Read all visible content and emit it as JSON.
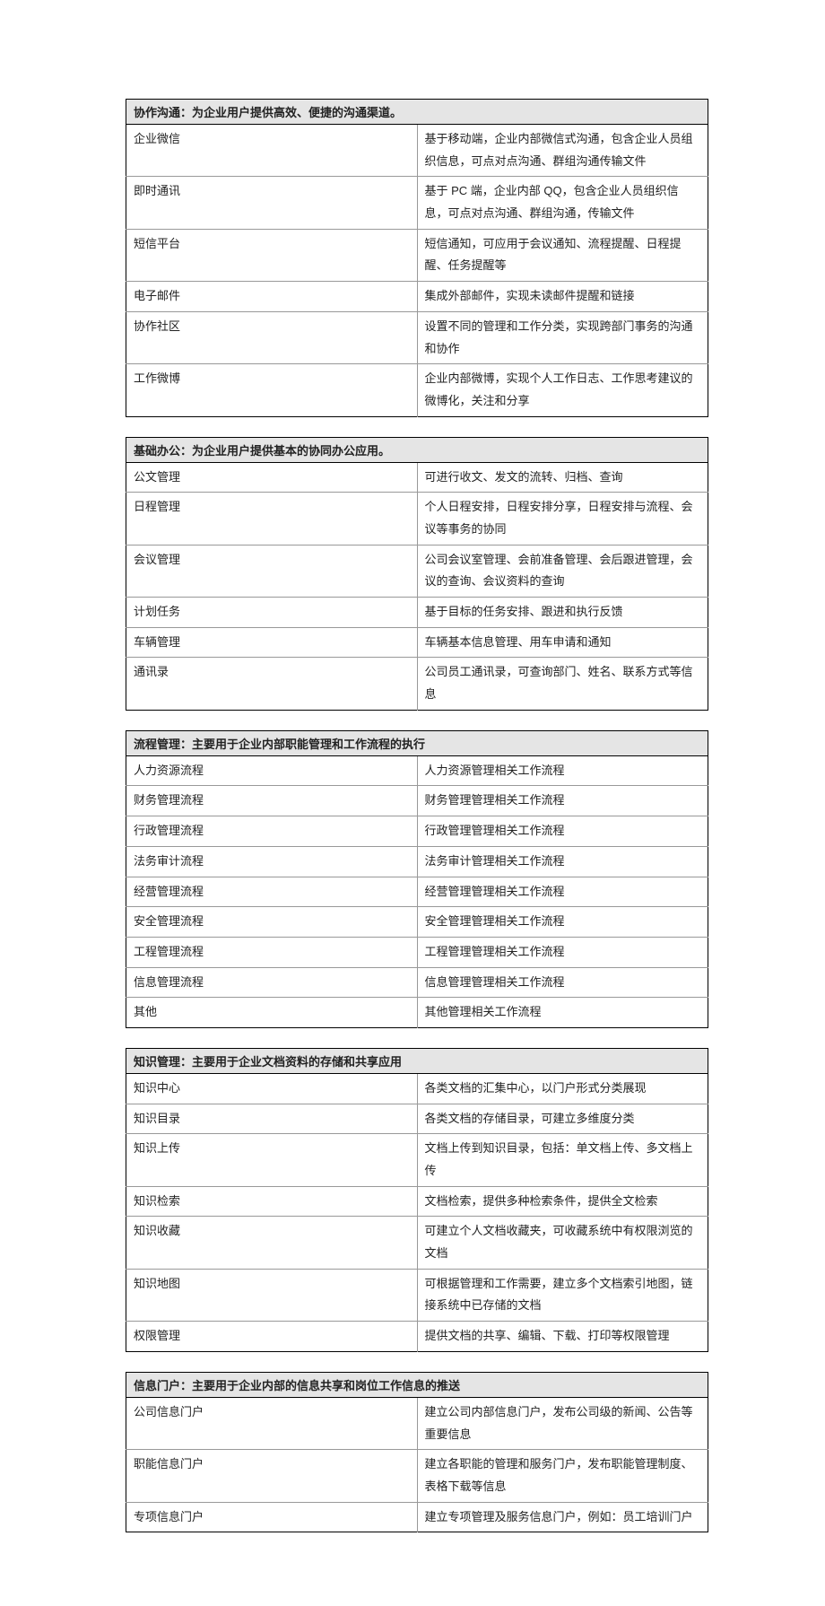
{
  "sections": [
    {
      "header": "协作沟通：为企业用户提供高效、便捷的沟通渠道。",
      "rows": [
        {
          "label": "企业微信",
          "desc": "基于移动端，企业内部微信式沟通，包含企业人员组织信息，可点对点沟通、群组沟通传输文件"
        },
        {
          "label": "即时通讯",
          "desc": "基于 PC 端，企业内部 QQ，包含企业人员组织信息，可点对点沟通、群组沟通，传输文件"
        },
        {
          "label": "短信平台",
          "desc": "短信通知，可应用于会议通知、流程提醒、日程提醒、任务提醒等"
        },
        {
          "label": "电子邮件",
          "desc": "集成外部邮件，实现未读邮件提醒和链接"
        },
        {
          "label": "协作社区",
          "desc": "设置不同的管理和工作分类，实现跨部门事务的沟通和协作"
        },
        {
          "label": "工作微博",
          "desc": "企业内部微博，实现个人工作日志、工作思考建议的微博化，关注和分享"
        }
      ]
    },
    {
      "header": "基础办公：为企业用户提供基本的协同办公应用。",
      "rows": [
        {
          "label": "公文管理",
          "desc": "可进行收文、发文的流转、归档、查询"
        },
        {
          "label": "日程管理",
          "desc": "个人日程安排，日程安排分享，日程安排与流程、会议等事务的协同"
        },
        {
          "label": "会议管理",
          "desc": "公司会议室管理、会前准备管理、会后跟进管理，会议的查询、会议资料的查询"
        },
        {
          "label": "计划任务",
          "desc": "基于目标的任务安排、跟进和执行反馈"
        },
        {
          "label": "车辆管理",
          "desc": "车辆基本信息管理、用车申请和通知"
        },
        {
          "label": "通讯录",
          "desc": "公司员工通讯录，可查询部门、姓名、联系方式等信息"
        }
      ]
    },
    {
      "header": "流程管理：主要用于企业内部职能管理和工作流程的执行",
      "rows": [
        {
          "label": "人力资源流程",
          "desc": "人力资源管理相关工作流程"
        },
        {
          "label": "财务管理流程",
          "desc": "财务管理管理相关工作流程"
        },
        {
          "label": "行政管理流程",
          "desc": "行政管理管理相关工作流程"
        },
        {
          "label": "法务审计流程",
          "desc": "法务审计管理相关工作流程"
        },
        {
          "label": "经营管理流程",
          "desc": "经营管理管理相关工作流程"
        },
        {
          "label": "安全管理流程",
          "desc": "安全管理管理相关工作流程"
        },
        {
          "label": "工程管理流程",
          "desc": "工程管理管理相关工作流程"
        },
        {
          "label": "信息管理流程",
          "desc": "信息管理管理相关工作流程"
        },
        {
          "label": "其他",
          "desc": "其他管理相关工作流程"
        }
      ]
    },
    {
      "header": "知识管理：主要用于企业文档资料的存储和共享应用",
      "rows": [
        {
          "label": "知识中心",
          "desc": "各类文档的汇集中心，以门户形式分类展现"
        },
        {
          "label": "知识目录",
          "desc": "各类文档的存储目录，可建立多维度分类"
        },
        {
          "label": "知识上传",
          "desc": "文档上传到知识目录，包括：单文档上传、多文档上传"
        },
        {
          "label": "知识检索",
          "desc": "文档检索，提供多种检索条件，提供全文检索"
        },
        {
          "label": "知识收藏",
          "desc": "可建立个人文档收藏夹，可收藏系统中有权限浏览的文档"
        },
        {
          "label": "知识地图",
          "desc": "可根据管理和工作需要，建立多个文档索引地图，链接系统中已存储的文档"
        },
        {
          "label": "权限管理",
          "desc": "提供文档的共享、编辑、下载、打印等权限管理"
        }
      ]
    },
    {
      "header": "信息门户：主要用于企业内部的信息共享和岗位工作信息的推送",
      "rows": [
        {
          "label": "公司信息门户",
          "desc": "建立公司内部信息门户，发布公司级的新闻、公告等重要信息"
        },
        {
          "label": "职能信息门户",
          "desc": "建立各职能的管理和服务门户，发布职能管理制度、表格下载等信息"
        },
        {
          "label": "专项信息门户",
          "desc": "建立专项管理及服务信息门户，例如：员工培训门户"
        }
      ]
    }
  ]
}
